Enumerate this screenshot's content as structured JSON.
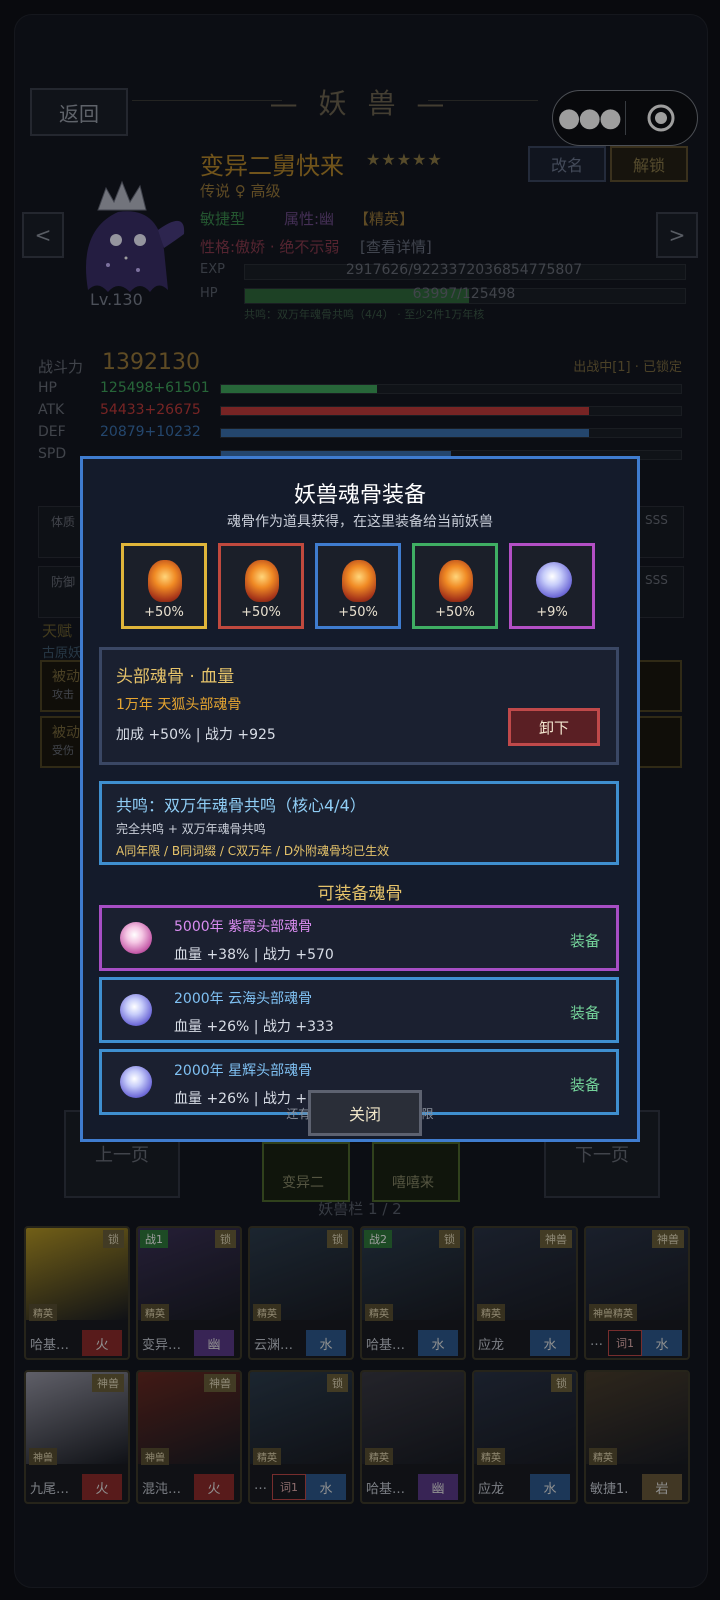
{
  "header": {
    "back_label": "返回",
    "title": "— 妖 兽 —"
  },
  "pet": {
    "name": "变异二舅快来",
    "stars": "★★★★★",
    "rarity": "传说 ♀ 高级",
    "level": "Lv.130",
    "type": "敏捷型",
    "attribute": "属性:幽",
    "class_tag": "【精英】",
    "personality": "性格:傲娇 · 绝不示弱",
    "detail_link": "[查看详情]",
    "rename_label": "改名",
    "unlock_label": "解锁",
    "exp_label": "EXP",
    "exp_value": "2917626/9223372036854775807",
    "exp_fraction": 0.0,
    "hp_label": "HP",
    "hp_value": "63997/125498",
    "hp_fraction": 0.51,
    "resonance_note": "共鸣：双万年魂骨共鸣（4/4） · 至少2件1万年核",
    "power_label": "战斗力",
    "power_value": "1392130",
    "status": "出战中[1] · 已锁定"
  },
  "stats": [
    {
      "label": "HP",
      "value": "125498+61501",
      "color": "#3fa55c",
      "fraction": 0.34
    },
    {
      "label": "ATK",
      "value": "54433+26675",
      "color": "#c03a3a",
      "fraction": 0.8
    },
    {
      "label": "DEF",
      "value": "20879+10232",
      "color": "#3a72b0",
      "fraction": 0.8
    },
    {
      "label": "SPD",
      "value": "",
      "color": "#3a72b0",
      "fraction": 0.5
    }
  ],
  "modal": {
    "title": "妖兽魂骨装备",
    "subtitle": "魂骨作为道具获得，在这里装备给当前妖兽",
    "slots": [
      {
        "pct": "+50%",
        "border": "#e0b53a",
        "gem": "orange"
      },
      {
        "pct": "+50%",
        "border": "#c0493e",
        "gem": "orange"
      },
      {
        "pct": "+50%",
        "border": "#3f7ccf",
        "gem": "orange"
      },
      {
        "pct": "+50%",
        "border": "#3fae63",
        "gem": "orange"
      },
      {
        "pct": "+9%",
        "border": "#b34fc5",
        "gem": "blue"
      }
    ],
    "selected": {
      "title": "头部魂骨 · 血量",
      "name": "1万年 天狐头部魂骨",
      "stats": "加成 +50%  |  战力 +925",
      "unequip_label": "卸下"
    },
    "resonance": {
      "title": "共鸣：双万年魂骨共鸣（核心4/4）",
      "line1": "完全共鸣 + 双万年魂骨共鸣",
      "line2": "A同年限 / B同词缀 / C双万年 / D外附魂骨均已生效"
    },
    "list_title": "可装备魂骨",
    "items": [
      {
        "name": "5000年 紫霞头部魂骨",
        "stats": "血量 +38%  |  战力 +570",
        "action": "装备",
        "border": "#a74ec4",
        "name_color": "#d98cf0",
        "gem": "pink"
      },
      {
        "name": "2000年 云海头部魂骨",
        "stats": "血量 +26%  |  战力 +333",
        "action": "装备",
        "border": "#3f8fcf",
        "name_color": "#7fc0f2",
        "gem": "blue"
      },
      {
        "name": "2000年 星辉头部魂骨",
        "stats": "血量 +26%  |  战力 +",
        "action": "装备",
        "border": "#3f8fcf",
        "name_color": "#7fc0f2",
        "gem": "blue"
      }
    ],
    "footer_note": "还有 2 件，优先显示高年限",
    "close_label": "关闭"
  },
  "background": {
    "talent_label": "天赋",
    "talent_sub": "古原妖",
    "passive1": "被动",
    "passive1_sub": "攻击",
    "passive2": "被动",
    "passive2_sub": "受伤",
    "side_labels": [
      "体质",
      "防御"
    ],
    "side_grades": [
      "SSS",
      "SSS"
    ],
    "prev_page": "上一页",
    "next_page": "下一页",
    "team1": "变异二",
    "team2": "嘻嘻来",
    "bar_label": "妖兽栏 1 / 2"
  },
  "grid": [
    {
      "name": "哈基…",
      "el": "火",
      "el_color": "#8e2d2d",
      "lock": "锁",
      "elite": "精英",
      "tag": "",
      "pic": "#b89a26"
    },
    {
      "name": "变异…",
      "el": "幽",
      "el_color": "#5b3a8a",
      "lock": "锁",
      "elite": "精英",
      "tag": "战1",
      "pic": "#3c3258"
    },
    {
      "name": "云渊…",
      "el": "水",
      "el_color": "#2e5a8e",
      "lock": "锁",
      "elite": "精英",
      "tag": "",
      "pic": "#2d3d4e"
    },
    {
      "name": "哈基…",
      "el": "水",
      "el_color": "#2e5a8e",
      "lock": "锁",
      "elite": "精英",
      "tag": "战2",
      "pic": "#2d3d4e"
    },
    {
      "name": "应龙",
      "el": "水",
      "el_color": "#2e5a8e",
      "lock": "神兽",
      "elite": "精英",
      "tag": "",
      "pic": "#2a3346"
    },
    {
      "name": "…",
      "el": "水",
      "el_color": "#2e5a8e",
      "lock": "神兽",
      "elite": "神兽精英",
      "tag": "",
      "pic": "#2a3346",
      "extra": "词1"
    },
    {
      "name": "九尾…",
      "el": "火",
      "el_color": "#8e2d2d",
      "lock": "神兽",
      "elite": "神兽",
      "tag": "",
      "pic": "#9a9aa8"
    },
    {
      "name": "混沌…",
      "el": "火",
      "el_color": "#8e2d2d",
      "lock": "神兽",
      "elite": "神兽",
      "tag": "",
      "pic": "#6a2a22"
    },
    {
      "name": "…",
      "el": "水",
      "el_color": "#2e5a8e",
      "lock": "锁",
      "elite": "精英",
      "tag": "",
      "pic": "#2d3d4e",
      "extra": "词1"
    },
    {
      "name": "哈基…",
      "el": "幽",
      "el_color": "#5b3a8a",
      "lock": "",
      "elite": "精英",
      "tag": "",
      "pic": "#3a3a44"
    },
    {
      "name": "应龙",
      "el": "水",
      "el_color": "#2e5a8e",
      "lock": "锁",
      "elite": "精英",
      "tag": "",
      "pic": "#2a3346"
    },
    {
      "name": "敏捷1.",
      "el": "岩",
      "el_color": "#6a5a3a",
      "lock": "",
      "elite": "精英",
      "tag": "",
      "pic": "#4a3e2e"
    }
  ]
}
